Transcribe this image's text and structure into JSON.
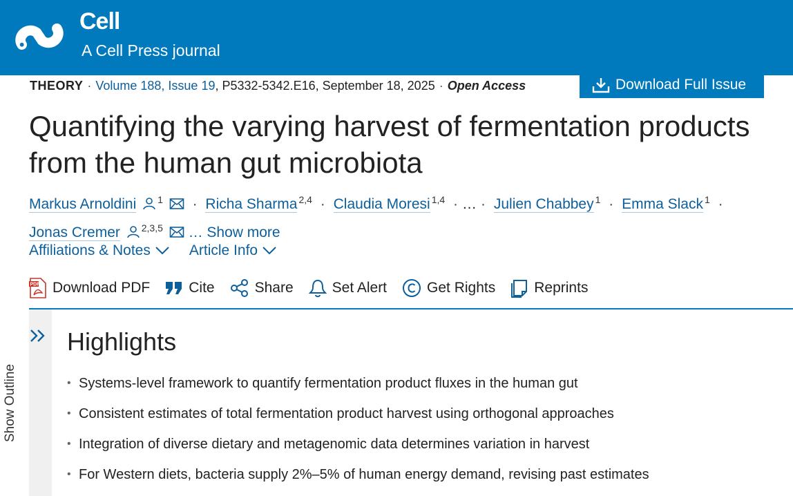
{
  "header": {
    "journal_name": "Cell",
    "tagline": "A Cell Press journal",
    "brand_color": "#0079bd"
  },
  "meta": {
    "type": "THEORY",
    "volume_issue": "Volume 188, Issue 19",
    "pages_date": "P5332-5342.E16, September 18, 2025",
    "access": "Open Access",
    "download_issue_label": "Download Full Issue"
  },
  "article": {
    "title": "Quantifying the varying harvest of fermentation products from the human gut microbiota"
  },
  "authors": [
    {
      "name": "Markus Arnoldini",
      "affil": "1",
      "person_icon": true,
      "mail_icon": true
    },
    {
      "name": "Richa Sharma",
      "affil": "2,4"
    },
    {
      "name": "Claudia Moresi",
      "affil": "1,4"
    },
    {
      "name": "Julien Chabbey",
      "affil": "1"
    },
    {
      "name": "Emma Slack",
      "affil": "1"
    },
    {
      "name": "Jonas Cremer",
      "affil": "2,3,5",
      "person_icon": true,
      "mail_icon": true
    }
  ],
  "authors_ellipsis": "…",
  "show_more_label": "… Show more",
  "toggles": {
    "affiliations": "Affiliations & Notes",
    "article_info": "Article Info"
  },
  "toolbar": {
    "download_pdf": "Download PDF",
    "cite": "Cite",
    "share": "Share",
    "set_alert": "Set Alert",
    "get_rights": "Get Rights",
    "reprints": "Reprints"
  },
  "outline": {
    "label": "Show Outline"
  },
  "highlights": {
    "title": "Highlights",
    "items": [
      "Systems-level framework to quantify fermentation product fluxes in the human gut",
      "Consistent estimates of total fermentation product harvest using orthogonal approaches",
      "Integration of diverse dietary and metagenomic data determines variation in harvest",
      "For Western diets, bacteria supply 2%–5% of human energy demand, revising past estimates"
    ]
  }
}
